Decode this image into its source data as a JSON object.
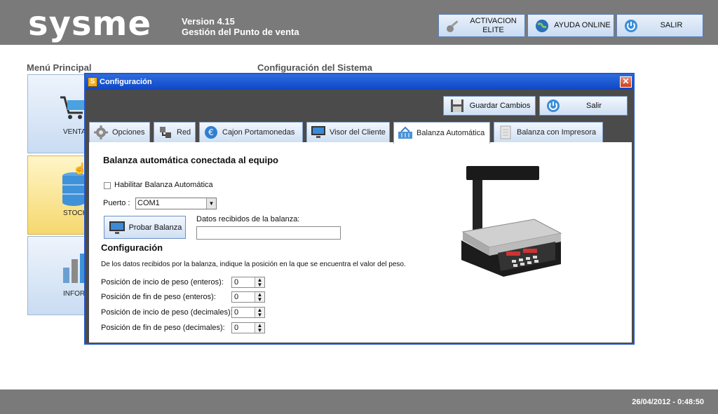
{
  "header": {
    "logo": "sysme",
    "version_line1": "Version 4.15",
    "version_line2": "Gestión del Punto de venta",
    "buttons": {
      "activation_line1": "ACTIVACION",
      "activation_line2": "ELITE",
      "help": "AYUDA ONLINE",
      "exit": "SALIR"
    }
  },
  "background": {
    "menu_title": "Menú Principal",
    "config_title": "Configuración del Sistema",
    "tiles": [
      "VENTA",
      "STOCK",
      "INFORM"
    ]
  },
  "dialog": {
    "title": "Configuración",
    "title_icon": "S",
    "close_glyph": "✕",
    "save_label": "Guardar Cambios",
    "exit_label": "Salir",
    "tabs": [
      {
        "label": "Opciones",
        "icon": "gear-icon"
      },
      {
        "label": "Red",
        "icon": "network-icon"
      },
      {
        "label": "Cajon Portamonedas",
        "icon": "euro-icon"
      },
      {
        "label": "Visor del Cliente",
        "icon": "monitor-icon"
      },
      {
        "label": "Balanza Automática",
        "icon": "basket-icon",
        "active": true
      },
      {
        "label": "Balanza con Impresora",
        "icon": "printer-icon"
      }
    ],
    "panel": {
      "heading": "Balanza automática conectada al equipo",
      "enable_checkbox_label": "Habilitar Balanza Automática",
      "enable_checked": false,
      "port_label": "Puerto :",
      "port_value": "COM1",
      "test_button": "Probar Balanza",
      "received_label": "Datos recibidos de la balanza:",
      "received_value": "",
      "config_heading": "Configuración",
      "config_description": "De los datos recibidos por la balanza, indique la posición en la que se encuentra el valor del peso.",
      "fields": [
        {
          "label": "Posición de incio de peso (enteros):",
          "value": "0"
        },
        {
          "label": "Posición de fin de peso (enteros):",
          "value": "0"
        },
        {
          "label": "Posición de incio de peso (decimales):",
          "value": "0"
        },
        {
          "label": "Posición de fin de peso (decimales):",
          "value": "0"
        }
      ]
    }
  },
  "footer": {
    "datetime": "26/04/2012 - 0:48:50"
  }
}
